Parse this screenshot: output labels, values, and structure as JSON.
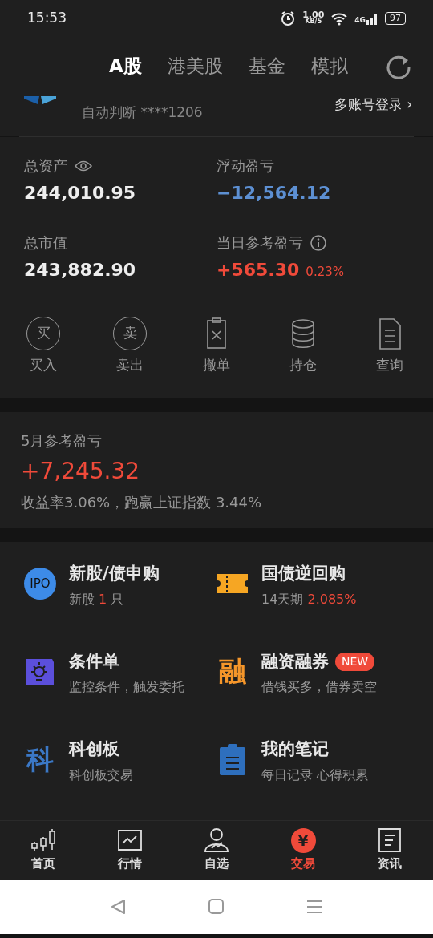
{
  "status_bar": {
    "time": "15:53",
    "speed": "1.00",
    "speed_unit": "KB/S",
    "network": "4G",
    "battery": "97"
  },
  "tabs": [
    {
      "label": "A股",
      "selected": true
    },
    {
      "label": "港美股",
      "selected": false
    },
    {
      "label": "基金",
      "selected": false
    },
    {
      "label": "模拟",
      "selected": false
    }
  ],
  "account": {
    "multi_login": "多账号登录 ›",
    "subtitle": "自动判断 ****1206"
  },
  "summary": [
    {
      "label": "总资产",
      "value": "244,010.95",
      "kind": "plain",
      "eye": true
    },
    {
      "label": "浮动盈亏",
      "value": "−12,564.12",
      "kind": "loss"
    },
    {
      "label": "总市值",
      "value": "243,882.90",
      "kind": "plain"
    },
    {
      "label": "当日参考盈亏",
      "value": "+565.30",
      "percent": "0.23%",
      "kind": "gain",
      "info": true
    }
  ],
  "actions": [
    {
      "kind": "circle",
      "glyph": "买",
      "label": "买入"
    },
    {
      "kind": "circle",
      "glyph": "卖",
      "label": "卖出"
    },
    {
      "kind": "cancel",
      "label": "撤单"
    },
    {
      "kind": "stack",
      "label": "持仓"
    },
    {
      "kind": "doc",
      "label": "查询"
    }
  ],
  "monthly": {
    "title": "5月参考盈亏",
    "value": "+7,245.32",
    "note": "收益率3.06%，跑赢上证指数 3.44%"
  },
  "services": [
    {
      "kind": "ipo",
      "glyph": "IPO",
      "title": "新股/债申购",
      "parts": [
        {
          "text": "新股 ",
          "accent": false
        },
        {
          "text": "1",
          "accent": true
        },
        {
          "text": " 只",
          "accent": false
        }
      ]
    },
    {
      "kind": "ticket",
      "title": "国债逆回购",
      "parts": [
        {
          "text": "14天期 ",
          "accent": false
        },
        {
          "text": "2.085%",
          "accent": true
        }
      ]
    },
    {
      "kind": "lamp",
      "title": "条件单",
      "parts": [
        {
          "text": "监控条件，触发委托",
          "accent": false
        }
      ]
    },
    {
      "kind": "glyph",
      "glyph": "融",
      "color": "#f5962a",
      "title": "融资融券",
      "badge": "NEW",
      "parts": [
        {
          "text": "借钱买多，借券卖空",
          "accent": false
        }
      ]
    },
    {
      "kind": "glyph",
      "glyph": "科",
      "color": "#3b78c6",
      "title": "科创板",
      "parts": [
        {
          "text": "科创板交易",
          "accent": false
        }
      ]
    },
    {
      "kind": "clipboard",
      "title": "我的笔记",
      "parts": [
        {
          "text": "每日记录 心得积累",
          "accent": false
        }
      ]
    }
  ],
  "bottom_nav": [
    {
      "kind": "candles",
      "label": "首页",
      "selected": false
    },
    {
      "kind": "chart",
      "label": "行情",
      "selected": false
    },
    {
      "kind": "person",
      "label": "自选",
      "selected": false
    },
    {
      "kind": "yen",
      "glyph": "¥",
      "label": "交易",
      "selected": true
    },
    {
      "kind": "news",
      "label": "资讯",
      "selected": false
    }
  ]
}
